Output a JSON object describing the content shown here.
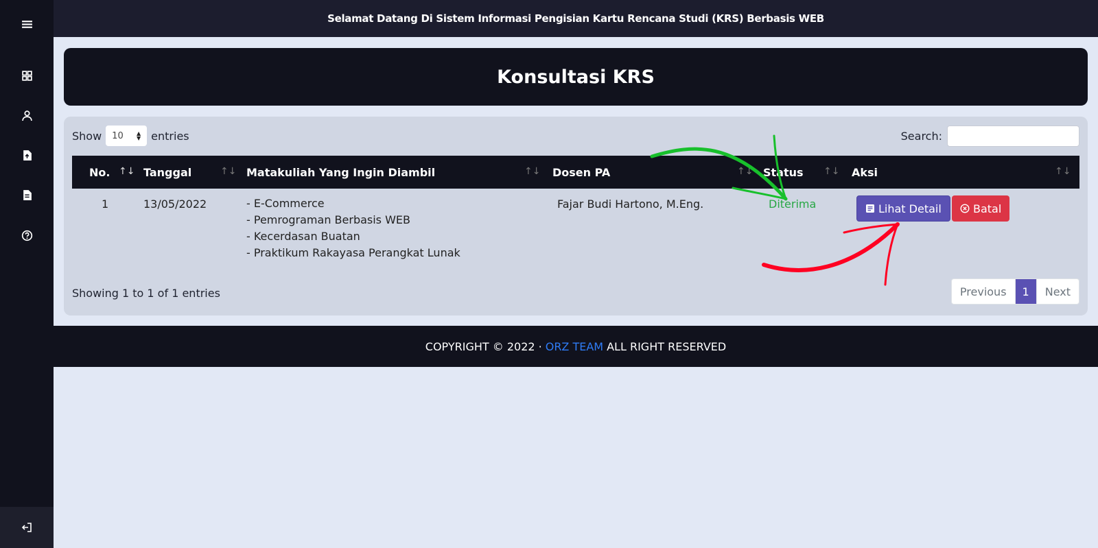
{
  "topbar": {
    "welcome": "Selamat Datang Di Sistem Informasi Pengisian Kartu Rencana Studi (KRS) Berbasis WEB"
  },
  "page": {
    "title": "Konsultasi KRS"
  },
  "sidebar": {
    "items": [
      {
        "icon": "menu-icon"
      },
      {
        "icon": "dashboard-icon"
      },
      {
        "icon": "user-icon"
      },
      {
        "icon": "file-upload-icon"
      },
      {
        "icon": "document-icon"
      },
      {
        "icon": "help-icon"
      }
    ],
    "logout_icon": "logout-icon"
  },
  "table_controls": {
    "show_label": "Show",
    "page_size": "10",
    "entries_label": "entries",
    "search_label": "Search:",
    "search_value": ""
  },
  "table": {
    "columns": [
      "No.",
      "Tanggal",
      "Matakuliah Yang Ingin Diambil",
      "Dosen PA",
      "Status",
      "Aksi"
    ],
    "rows": [
      {
        "no": "1",
        "tanggal": "13/05/2022",
        "courses": [
          "- E-Commerce",
          "- Pemrograman Berbasis WEB",
          "- Kecerdasan Buatan",
          "- Praktikum Rakayasa Perangkat Lunak"
        ],
        "dosen": "Fajar Budi Hartono, M.Eng.",
        "status": "Diterima",
        "detail_label": "Lihat Detail",
        "cancel_label": "Batal"
      }
    ]
  },
  "pagination": {
    "info": "Showing 1 to 1 of 1 entries",
    "previous": "Previous",
    "current": "1",
    "next": "Next"
  },
  "footer": {
    "prefix": "COPYRIGHT © 2022 ·",
    "brand": "ORZ TEAM",
    "suffix": "ALL RIGHT RESERVED"
  },
  "colors": {
    "sidebar": "#11121d",
    "topbar": "#1c1d2e",
    "background": "#e2e8f5",
    "panel": "#d0d6e3",
    "primary": "#5a51b3",
    "danger": "#dc3545",
    "success": "#28a745",
    "brand_link": "#2f7cf6",
    "annotation_green": "#18c02c",
    "annotation_red": "#ff0022"
  }
}
